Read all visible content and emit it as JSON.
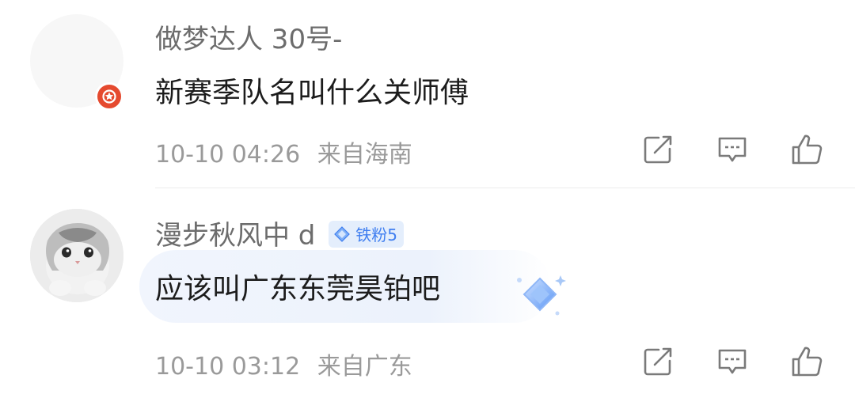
{
  "comments": [
    {
      "username": "做梦达人 30号-",
      "content": "新赛季队名叫什么关师傅",
      "time": "10-10 04:26",
      "location": "来自海南",
      "verified_badge_color": "#e54a2f"
    },
    {
      "username": "漫步秋风中 d",
      "fan_badge": "铁粉5",
      "content": "应该叫广东东莞昊铂吧",
      "time": "10-10 03:12",
      "location": "来自广东",
      "badge_color": "#3f7ef0"
    }
  ],
  "actions": {
    "icons": [
      "share-icon",
      "comment-icon",
      "like-icon"
    ]
  },
  "colors": {
    "text_primary": "#1c1c1c",
    "text_secondary": "#6c6c6c",
    "text_meta": "#9a9a9a",
    "accent_blue": "#3f7ef0",
    "accent_red": "#e54a2f"
  }
}
